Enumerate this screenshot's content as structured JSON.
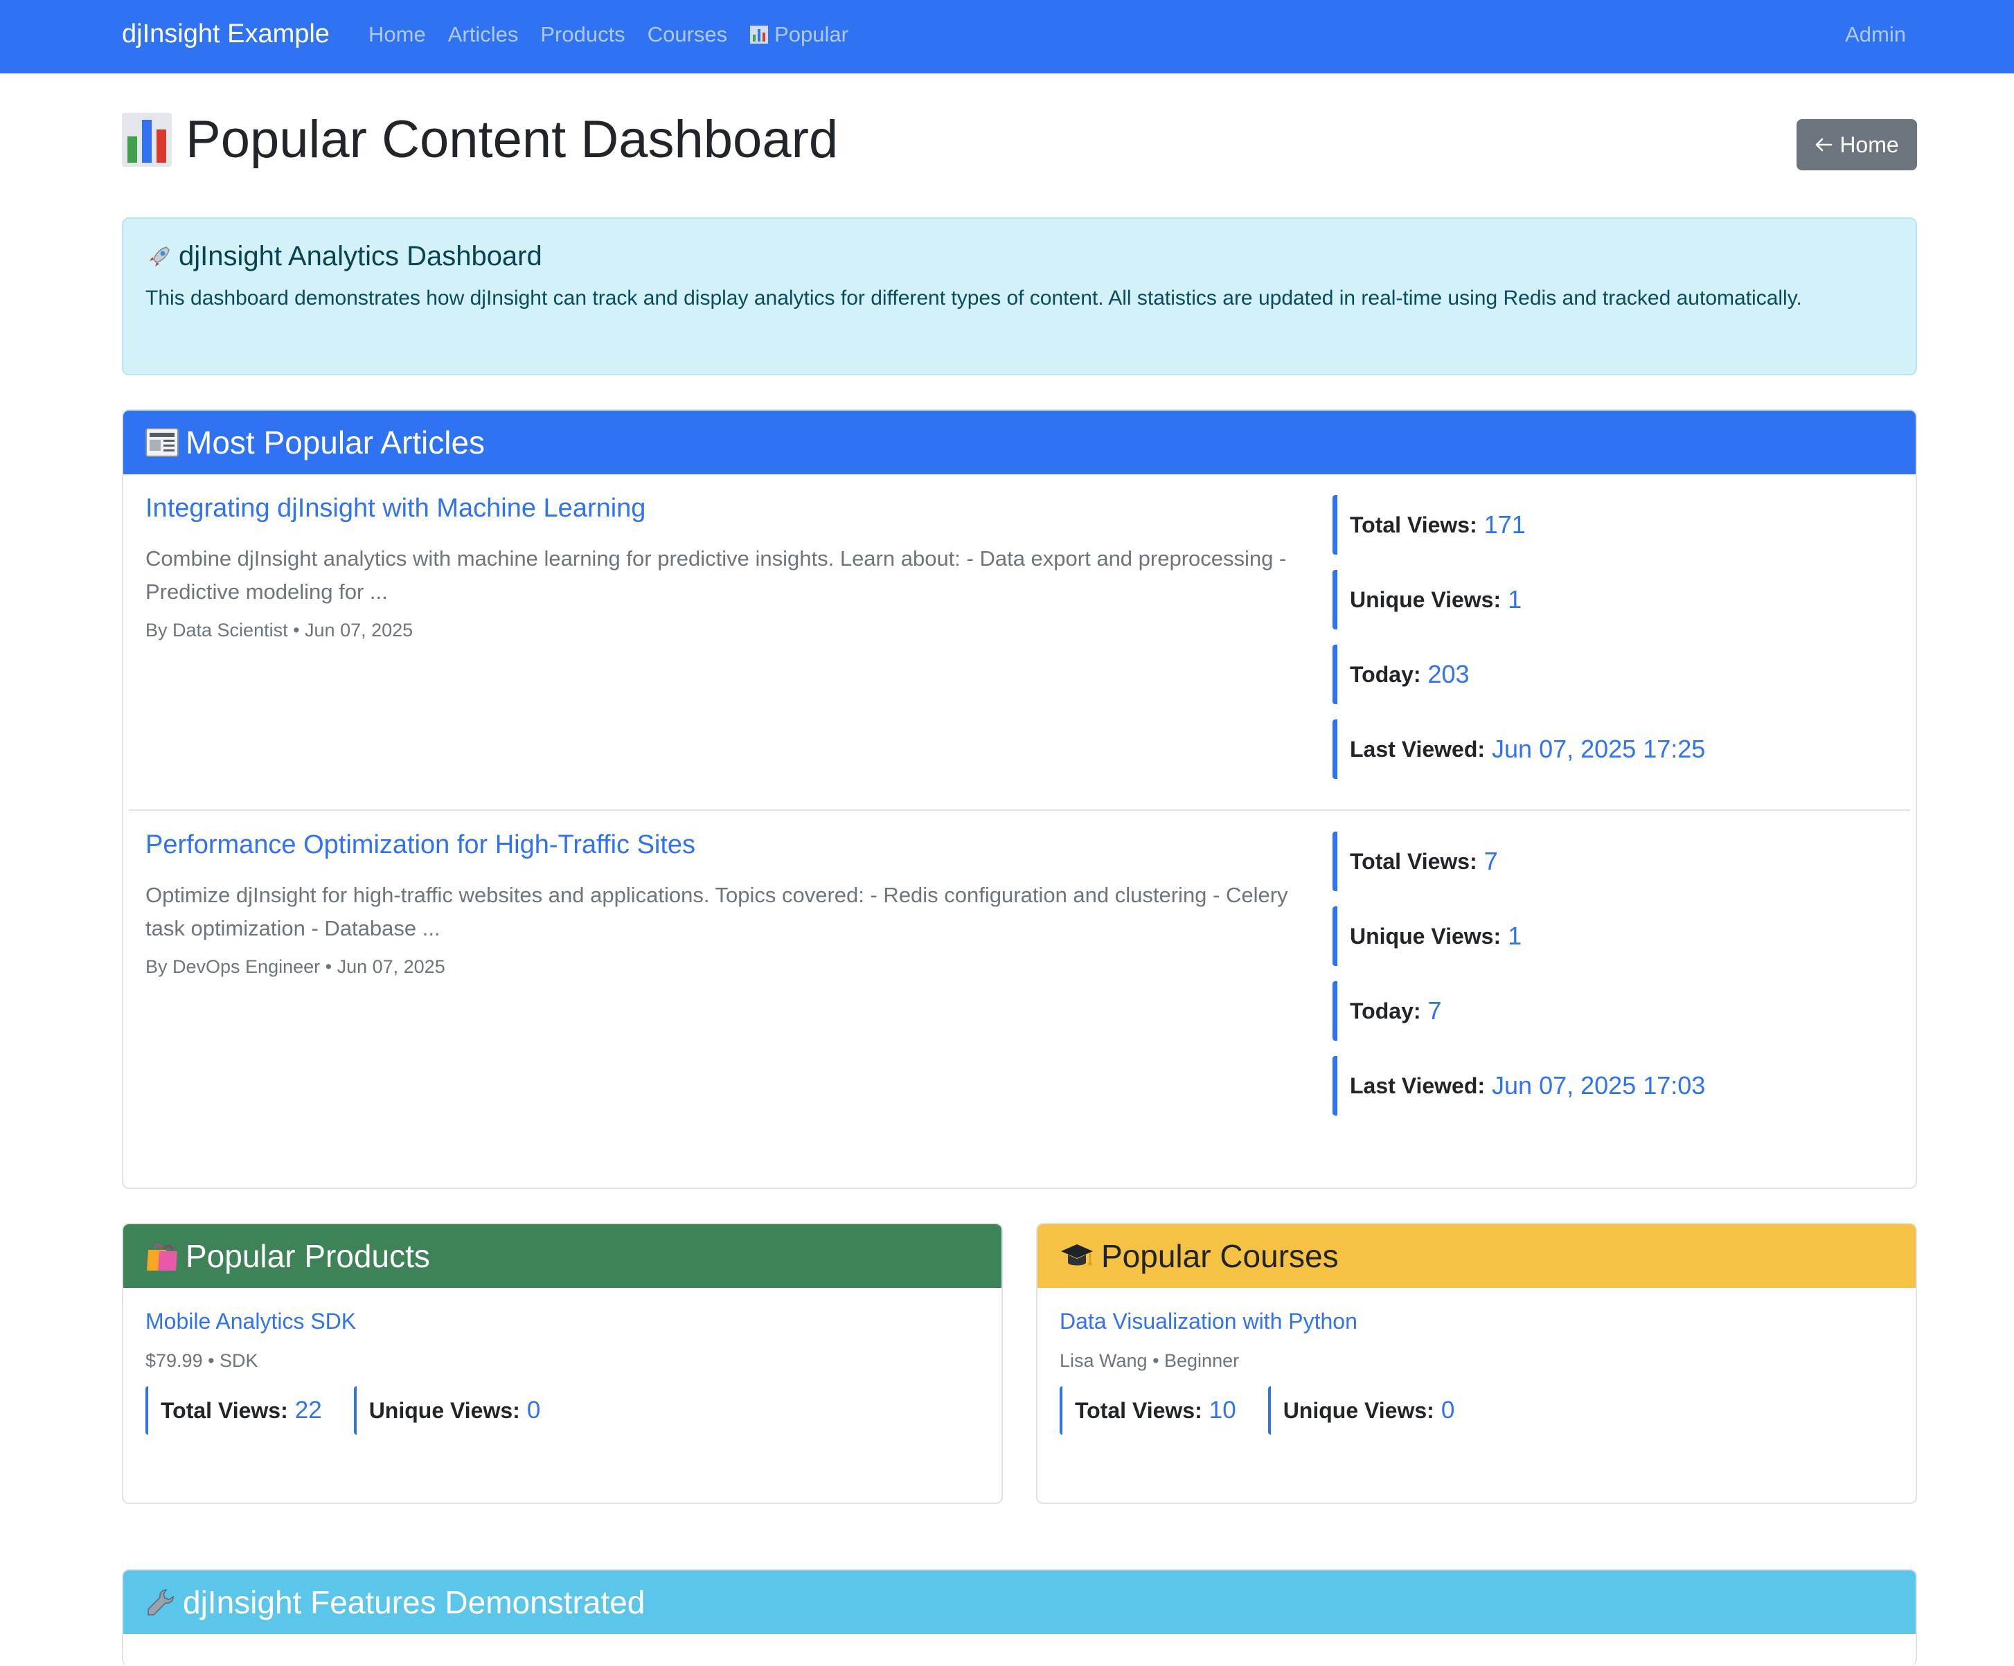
{
  "navbar": {
    "brand": "djInsight Example",
    "links": [
      "Home",
      "Articles",
      "Products",
      "Courses",
      "Popular"
    ],
    "popular_icon": "bar-chart-icon",
    "admin": "Admin"
  },
  "header": {
    "title": "Popular Content Dashboard",
    "title_icon": "bar-chart-icon",
    "home_button": "Home",
    "home_button_icon": "arrow-left-icon"
  },
  "alert": {
    "icon": "rocket-icon",
    "title": "djInsight Analytics Dashboard",
    "body": "This dashboard demonstrates how djInsight can track and display analytics for different types of content. All statistics are updated in real-time using Redis and tracked automatically."
  },
  "articles": {
    "icon": "newspaper-icon",
    "title": "Most Popular Articles",
    "items": [
      {
        "title": "Integrating djInsight with Machine Learning",
        "description": "Combine djInsight analytics with machine learning for predictive insights. Learn about: - Data export and preprocessing - Predictive modeling for ...",
        "meta": "By Data Scientist • Jun 07, 2025",
        "stats": [
          {
            "label": "Total Views:",
            "value": "171"
          },
          {
            "label": "Unique Views:",
            "value": "1"
          },
          {
            "label": "Today:",
            "value": "203"
          },
          {
            "label": "Last Viewed:",
            "value": "Jun 07, 2025 17:25"
          }
        ]
      },
      {
        "title": "Performance Optimization for High-Traffic Sites",
        "description": "Optimize djInsight for high-traffic websites and applications. Topics covered: - Redis configuration and clustering - Celery task optimization - Database ...",
        "meta": "By DevOps Engineer • Jun 07, 2025",
        "stats": [
          {
            "label": "Total Views:",
            "value": "7"
          },
          {
            "label": "Unique Views:",
            "value": "1"
          },
          {
            "label": "Today:",
            "value": "7"
          },
          {
            "label": "Last Viewed:",
            "value": "Jun 07, 2025 17:03"
          }
        ]
      }
    ]
  },
  "products": {
    "icon": "shopping-bags-icon",
    "title": "Popular Products",
    "item": {
      "title": "Mobile Analytics SDK",
      "meta": "$79.99 • SDK",
      "total_label": "Total Views:",
      "total_value": "22",
      "unique_label": "Unique Views:",
      "unique_value": "0"
    }
  },
  "courses": {
    "icon": "graduation-cap-icon",
    "title": "Popular Courses",
    "item": {
      "title": "Data Visualization with Python",
      "meta": "Lisa Wang • Beginner",
      "total_label": "Total Views:",
      "total_value": "10",
      "unique_label": "Unique Views:",
      "unique_value": "0"
    }
  },
  "features": {
    "icon": "wrench-icon",
    "title": "djInsight Features Demonstrated"
  },
  "colors": {
    "primary": "#2f72f2",
    "success": "#3e8357",
    "warning": "#f6c244",
    "info": "#5cc6ea",
    "secondary": "#6c757d"
  }
}
